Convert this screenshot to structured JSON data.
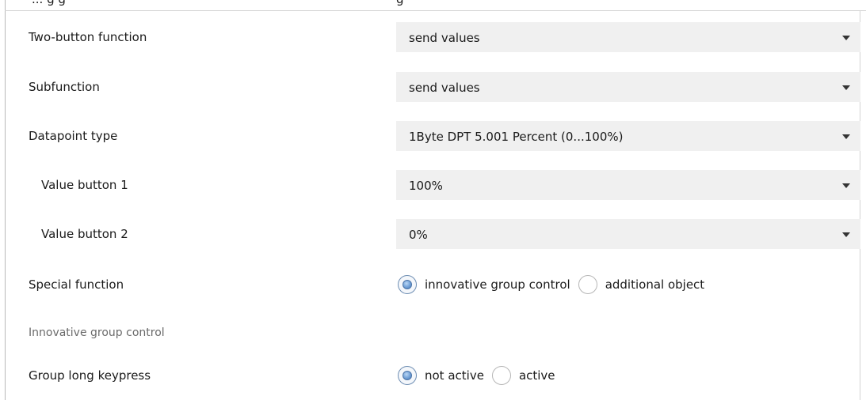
{
  "header_partial": {
    "left_text": "... g g",
    "right_text": "g"
  },
  "rows": [
    {
      "label": "Two-button function",
      "type": "select",
      "value": "send values"
    },
    {
      "label": "Subfunction",
      "type": "select",
      "value": "send values"
    },
    {
      "label": "Datapoint type",
      "type": "select",
      "value": "1Byte DPT 5.001 Percent (0...100%)"
    },
    {
      "label": "Value button 1",
      "type": "select",
      "value": "100%"
    },
    {
      "label": "Value button 2",
      "type": "select",
      "value": "0%"
    },
    {
      "label": "Special function",
      "type": "radio",
      "options": [
        "innovative group control",
        "additional object"
      ],
      "selected": "innovative group control"
    },
    {
      "label": "Innovative group control",
      "type": "section"
    },
    {
      "label": "Group long keypress",
      "type": "radio",
      "options": [
        "not active",
        "active"
      ],
      "selected": "not active"
    }
  ],
  "icons": {
    "dropdown": "chevron-down-icon",
    "radio": "radio-circle-icon"
  },
  "colors": {
    "select_background": "#f0f0f0",
    "radio_selected": "#6f9fd6",
    "section_text": "#6b6b6b"
  }
}
